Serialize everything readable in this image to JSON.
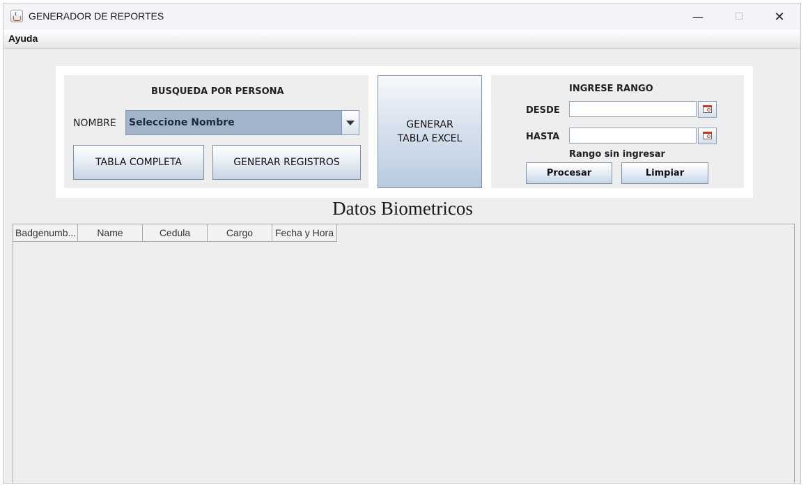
{
  "window": {
    "title": "GENERADOR DE REPORTES",
    "controls": {
      "minimize": "—",
      "maximize": "☐",
      "close": "✕"
    }
  },
  "menubar": {
    "items": [
      {
        "label": "Ayuda"
      }
    ]
  },
  "search_person": {
    "title": "BUSQUEDA POR PERSONA",
    "name_label": "NOMBRE",
    "name_select_value": "Seleccione Nombre",
    "full_table_button": "TABLA COMPLETA",
    "generate_records_button": "GENERAR REGISTROS"
  },
  "excel_button": {
    "line1": "GENERAR",
    "line2": "TABLA EXCEL"
  },
  "range": {
    "title": "INGRESE RANGO",
    "from_label": "DESDE",
    "from_value": "",
    "to_label": "HASTA",
    "to_value": "",
    "status": "Rango sin ingresar",
    "process_button": "Procesar",
    "clear_button": "Limpiar"
  },
  "table": {
    "title": "Datos Biometricos",
    "columns": [
      "Badgenumb...",
      "Name",
      "Cedula",
      "Cargo",
      "Fecha y Hora"
    ],
    "rows": []
  },
  "icons": {
    "app": "java-cup-icon",
    "date_picker": "calendar-icon",
    "combo_arrow": "chevron-down-icon"
  },
  "colors": {
    "combo_bg": "#a3b3c9",
    "button_gradient_end": "#c6d5e6",
    "panel_bg": "#eeeeee"
  }
}
